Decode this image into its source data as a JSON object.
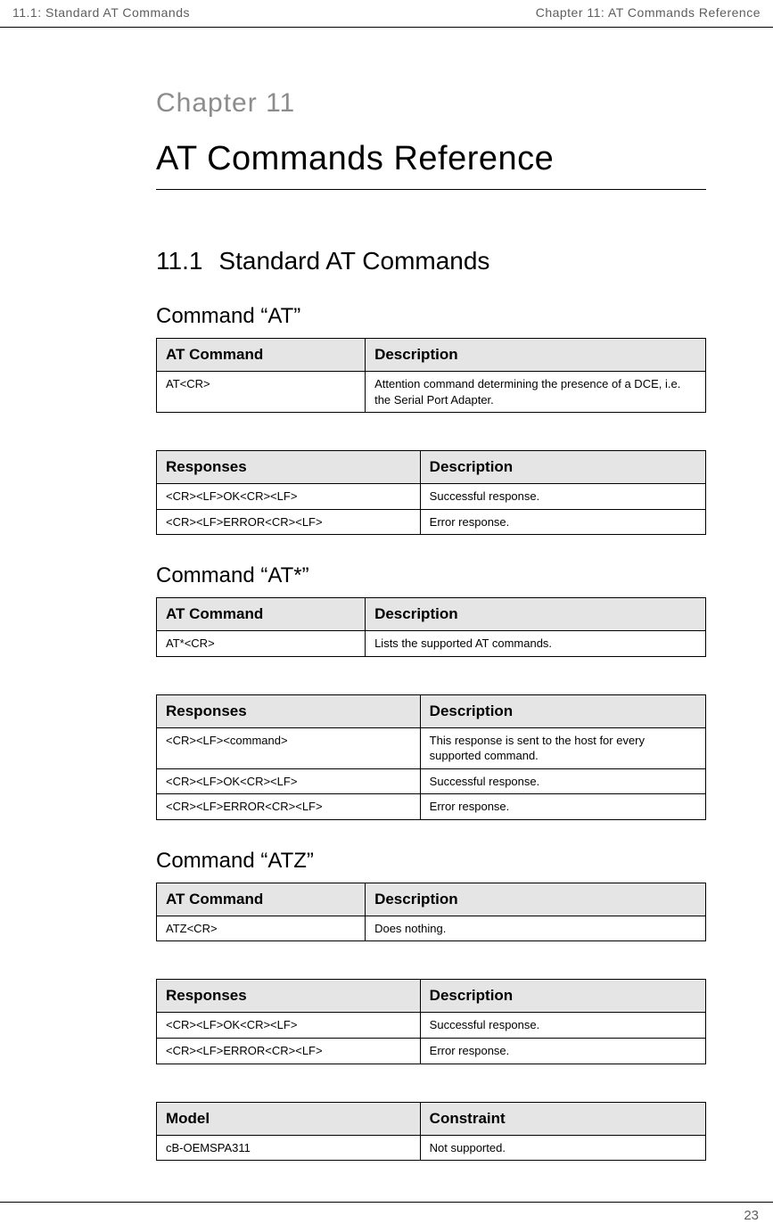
{
  "header": {
    "left": "11.1: Standard AT Commands",
    "right": "Chapter 11: AT Commands Reference"
  },
  "chapter": {
    "label": "Chapter 11",
    "title": "AT Commands Reference"
  },
  "section": {
    "num": "11.1",
    "title": "Standard AT Commands"
  },
  "commands": [
    {
      "title": "Command “AT”",
      "cmd": {
        "h1": "AT Command",
        "h2": "Description",
        "rows": [
          {
            "c1": "AT<CR>",
            "c2": "Attention command determining the presence of a DCE, i.e. the Serial Port Adapter."
          }
        ]
      },
      "resp": {
        "h1": "Responses",
        "h2": "Description",
        "rows": [
          {
            "c1": "<CR><LF>OK<CR><LF>",
            "c2": "Successful response."
          },
          {
            "c1": "<CR><LF>ERROR<CR><LF>",
            "c2": "Error response."
          }
        ]
      }
    },
    {
      "title": "Command “AT*”",
      "cmd": {
        "h1": "AT Command",
        "h2": "Description",
        "rows": [
          {
            "c1": "AT*<CR>",
            "c2": "Lists the supported AT commands."
          }
        ]
      },
      "resp": {
        "h1": "Responses",
        "h2": "Description",
        "rows": [
          {
            "c1": "<CR><LF><command>",
            "c2": "This response is sent to the host for every supported command."
          },
          {
            "c1": "<CR><LF>OK<CR><LF>",
            "c2": "Successful response."
          },
          {
            "c1": "<CR><LF>ERROR<CR><LF>",
            "c2": "Error response."
          }
        ]
      }
    },
    {
      "title": "Command “ATZ”",
      "cmd": {
        "h1": "AT Command",
        "h2": "Description",
        "rows": [
          {
            "c1": "ATZ<CR>",
            "c2": "Does nothing."
          }
        ]
      },
      "resp": {
        "h1": "Responses",
        "h2": "Description",
        "rows": [
          {
            "c1": "<CR><LF>OK<CR><LF>",
            "c2": "Successful response."
          },
          {
            "c1": "<CR><LF>ERROR<CR><LF>",
            "c2": "Error response."
          }
        ]
      },
      "model": {
        "h1": "Model",
        "h2": "Constraint",
        "rows": [
          {
            "c1": "cB-OEMSPA311",
            "c2": "Not supported."
          }
        ]
      }
    }
  ],
  "footer": {
    "page": "23"
  }
}
